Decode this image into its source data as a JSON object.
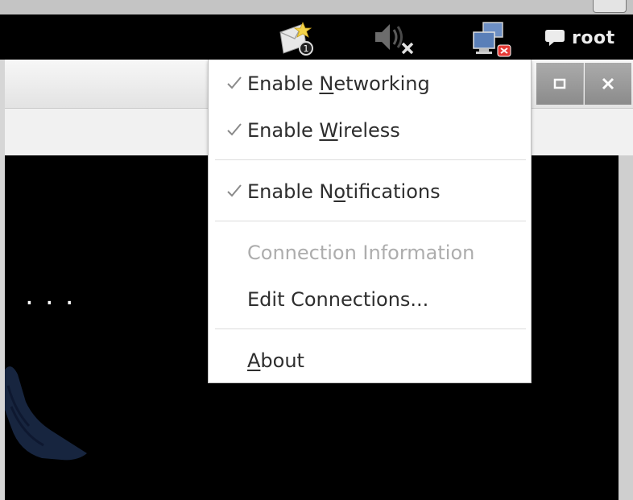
{
  "tray": {
    "icons": [
      "mail-notification-icon",
      "speaker-muted-icon",
      "network-disconnected-icon"
    ],
    "user": {
      "icon": "chat-bubble-icon",
      "name": "root"
    }
  },
  "window": {
    "buttons": [
      "maximize-icon",
      "close-icon"
    ],
    "content_text": "..."
  },
  "network_menu": {
    "items": [
      {
        "label_before": "Enable ",
        "mnemonic": "N",
        "label_after": "etworking",
        "checked": true,
        "enabled": true
      },
      {
        "label_before": "Enable ",
        "mnemonic": "W",
        "label_after": "ireless",
        "checked": true,
        "enabled": true
      },
      {
        "label_before": "Enable N",
        "mnemonic": "o",
        "label_after": "tifications",
        "checked": true,
        "enabled": true
      },
      {
        "label": "Connection Information",
        "enabled": false
      },
      {
        "label": "Edit Connections...",
        "enabled": true
      },
      {
        "label_before": "",
        "mnemonic": "A",
        "label_after": "bout",
        "enabled": true
      }
    ]
  },
  "colors": {
    "panel_bg": "#000000",
    "menu_bg": "#ffffff",
    "menu_text": "#2e2e2e",
    "menu_disabled_text": "#adadad",
    "check_mark": "#8a8a8a"
  }
}
